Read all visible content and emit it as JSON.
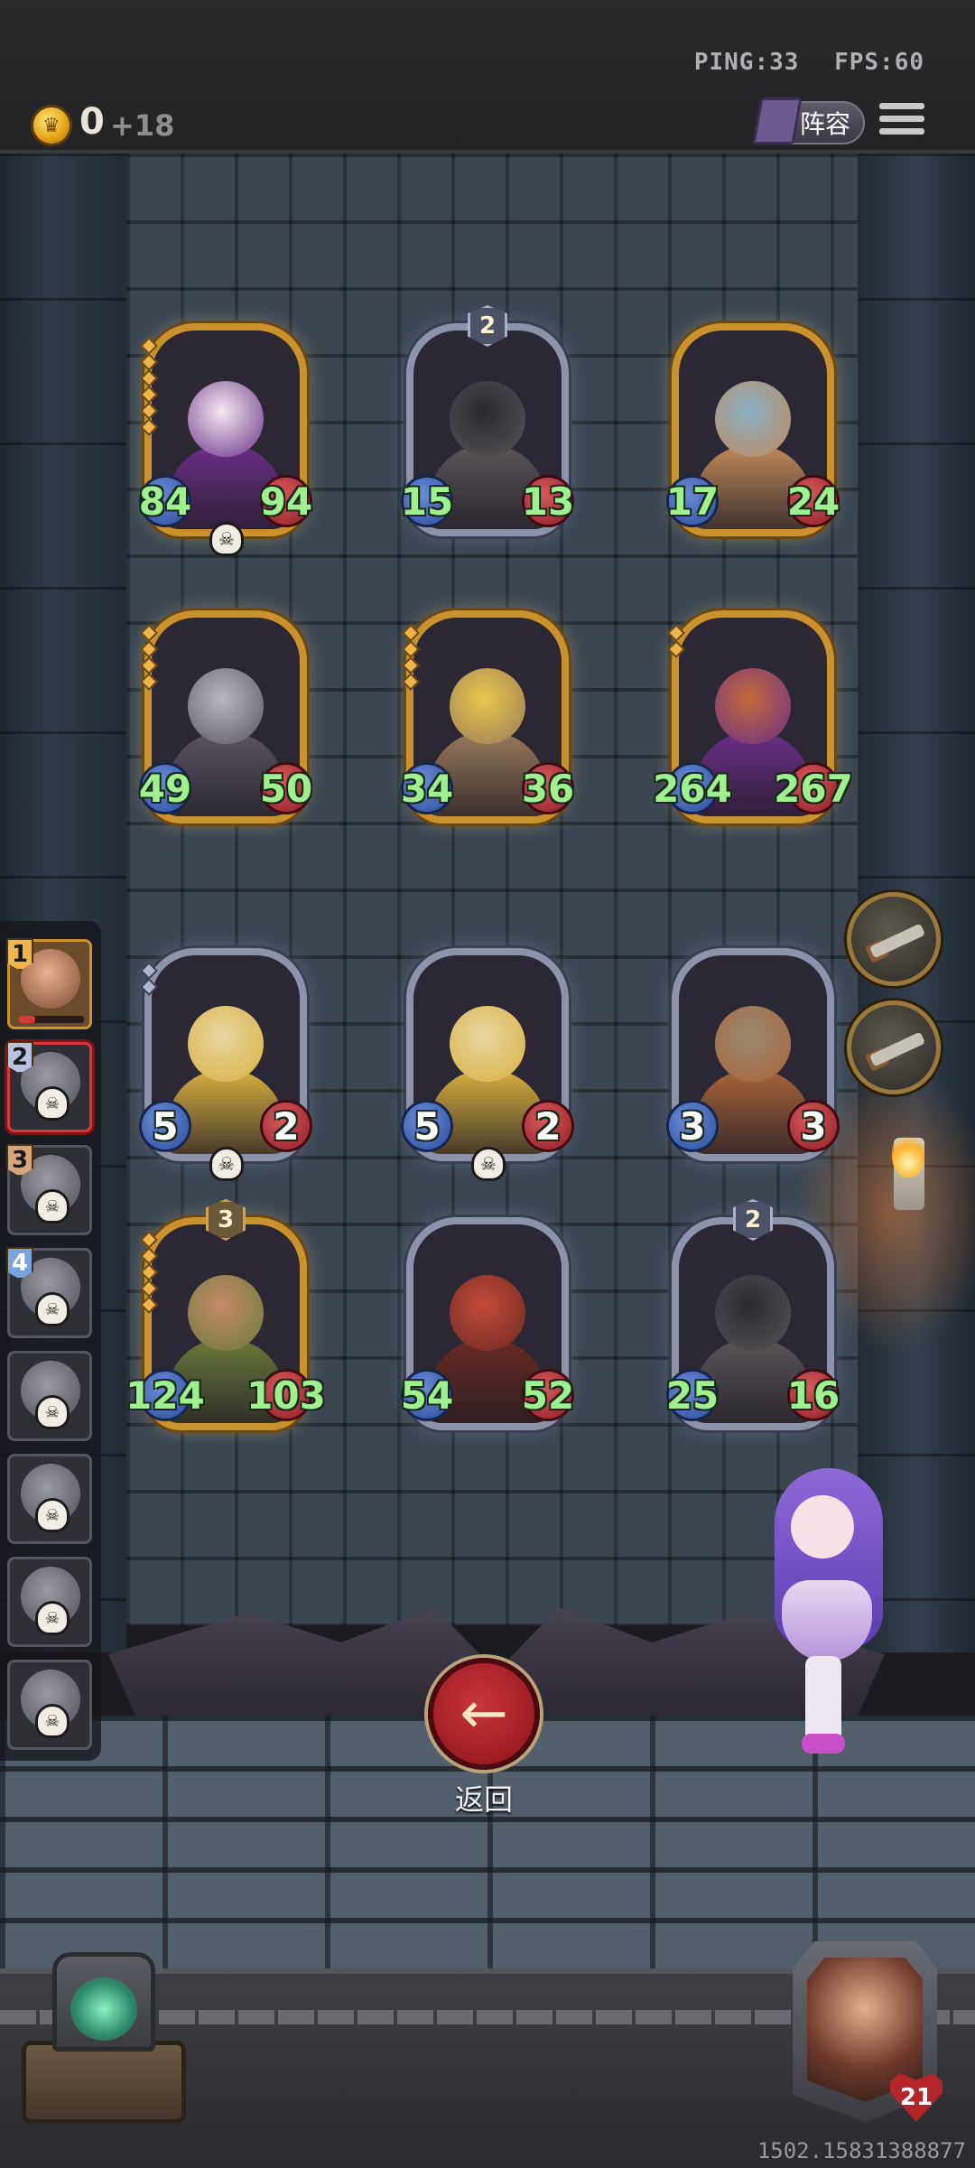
{
  "hud": {
    "ping": "PING:33",
    "fps": "FPS:60",
    "gold": "0",
    "gold_income": "+18",
    "lineup_label": "阵容"
  },
  "cards": [
    {
      "atk": "84",
      "hp": "94",
      "tier": "",
      "style": "gold",
      "skull": true,
      "pips": 6,
      "colors": [
        "#f2e9f0",
        "#6b2f86"
      ]
    },
    {
      "atk": "15",
      "hp": "13",
      "tier": "2",
      "style": "silver",
      "skull": false,
      "pips": 0,
      "colors": [
        "#2a2a30",
        "#5a5558"
      ]
    },
    {
      "atk": "17",
      "hp": "24",
      "tier": "",
      "style": "gold",
      "skull": false,
      "pips": 0,
      "colors": [
        "#8ab0c6",
        "#c08a5a"
      ]
    },
    {
      "atk": "49",
      "hp": "50",
      "tier": "",
      "style": "gold",
      "skull": false,
      "pips": 4,
      "colors": [
        "#b8b8c0",
        "#5a5560"
      ]
    },
    {
      "atk": "34",
      "hp": "36",
      "tier": "",
      "style": "gold",
      "skull": false,
      "pips": 4,
      "colors": [
        "#e8c84a",
        "#9a7a5a"
      ]
    },
    {
      "atk": "264",
      "hp": "267",
      "tier": "",
      "style": "gold",
      "skull": false,
      "pips": 2,
      "colors": [
        "#c46a3a",
        "#6b2f86"
      ]
    },
    {
      "atk": "5",
      "hp": "2",
      "tier": "",
      "style": "silver",
      "skull": true,
      "pips": 2,
      "colors": [
        "#e8d6a0",
        "#d9b040"
      ],
      "base": true
    },
    {
      "atk": "5",
      "hp": "2",
      "tier": "",
      "style": "silver",
      "skull": true,
      "pips": 0,
      "colors": [
        "#e8d6a0",
        "#d9b040"
      ],
      "base": true
    },
    {
      "atk": "3",
      "hp": "3",
      "tier": "",
      "style": "silver",
      "skull": false,
      "pips": 0,
      "colors": [
        "#9a8870",
        "#a8653a"
      ],
      "base": true
    },
    {
      "atk": "124",
      "hp": "103",
      "tier": "3",
      "style": "gold",
      "skull": false,
      "pips": 5,
      "colors": [
        "#c48a6a",
        "#6b7a3a"
      ]
    },
    {
      "atk": "54",
      "hp": "52",
      "tier": "",
      "style": "silver",
      "skull": false,
      "pips": 0,
      "colors": [
        "#c44a3a",
        "#6a2a22"
      ]
    },
    {
      "atk": "25",
      "hp": "16",
      "tier": "2",
      "style": "silver",
      "skull": false,
      "pips": 0,
      "colors": [
        "#2a2a30",
        "#5a5558"
      ]
    }
  ],
  "team": [
    {
      "num": "1",
      "num_style": "gold",
      "active": true,
      "selected": false,
      "skull": false,
      "hp_frac": 0.25
    },
    {
      "num": "2",
      "num_style": "silver",
      "active": false,
      "selected": true,
      "skull": true
    },
    {
      "num": "3",
      "num_style": "bronze",
      "active": false,
      "selected": false,
      "skull": true
    },
    {
      "num": "4",
      "num_style": "blue",
      "active": false,
      "selected": false,
      "skull": true
    },
    {
      "num": "",
      "active": false,
      "selected": false,
      "skull": true
    },
    {
      "num": "",
      "active": false,
      "selected": false,
      "skull": true
    },
    {
      "num": "",
      "active": false,
      "selected": false,
      "skull": true
    },
    {
      "num": "",
      "active": false,
      "selected": false,
      "skull": true
    }
  ],
  "items": [
    "rifle-icon",
    "rifle-icon"
  ],
  "back_label": "返回",
  "hero_hp": "21",
  "footer_id": "1502.15831388877",
  "icons": {
    "coin": "crown-coin-icon",
    "skull": "☠",
    "back": "←"
  }
}
